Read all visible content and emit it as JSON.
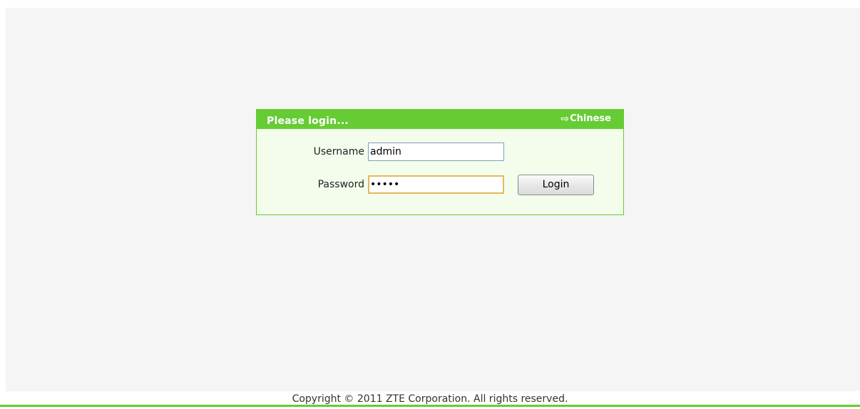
{
  "login": {
    "title": "Please login...",
    "language_link": "Chinese",
    "language_icon": "arrow-right-icon",
    "username_label": "Username",
    "username_value": "admin",
    "password_label": "Password",
    "password_value": "admin",
    "login_button": "Login"
  },
  "footer": {
    "copyright": "Copyright © 2011 ZTE Corporation. All rights reserved."
  },
  "colors": {
    "accent": "#66cc33",
    "box_background": "#f4fdeb",
    "page_background": "#f5f5f5",
    "focus_border": "#e6b85c"
  }
}
